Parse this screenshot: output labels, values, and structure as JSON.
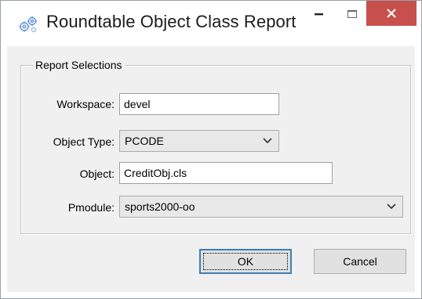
{
  "window": {
    "title": "Roundtable Object Class Report",
    "icon": "gear-cluster-icon",
    "controls": {
      "minimize": "minimize-icon",
      "maximize": "maximize-icon",
      "close": "close-icon",
      "close_color": "#c7504d"
    }
  },
  "group": {
    "label": "Report Selections"
  },
  "fields": {
    "workspace": {
      "label": "Workspace:",
      "value": "devel"
    },
    "object_type": {
      "label": "Object Type:",
      "value": "PCODE"
    },
    "object": {
      "label": "Object:",
      "value": "CreditObj.cls"
    },
    "pmodule": {
      "label": "Pmodule:",
      "value": "sports2000-oo"
    }
  },
  "buttons": {
    "ok": "OK",
    "cancel": "Cancel"
  },
  "colors": {
    "dialog_bg": "#f0f0f0",
    "default_button_border": "#3c7fb1"
  }
}
